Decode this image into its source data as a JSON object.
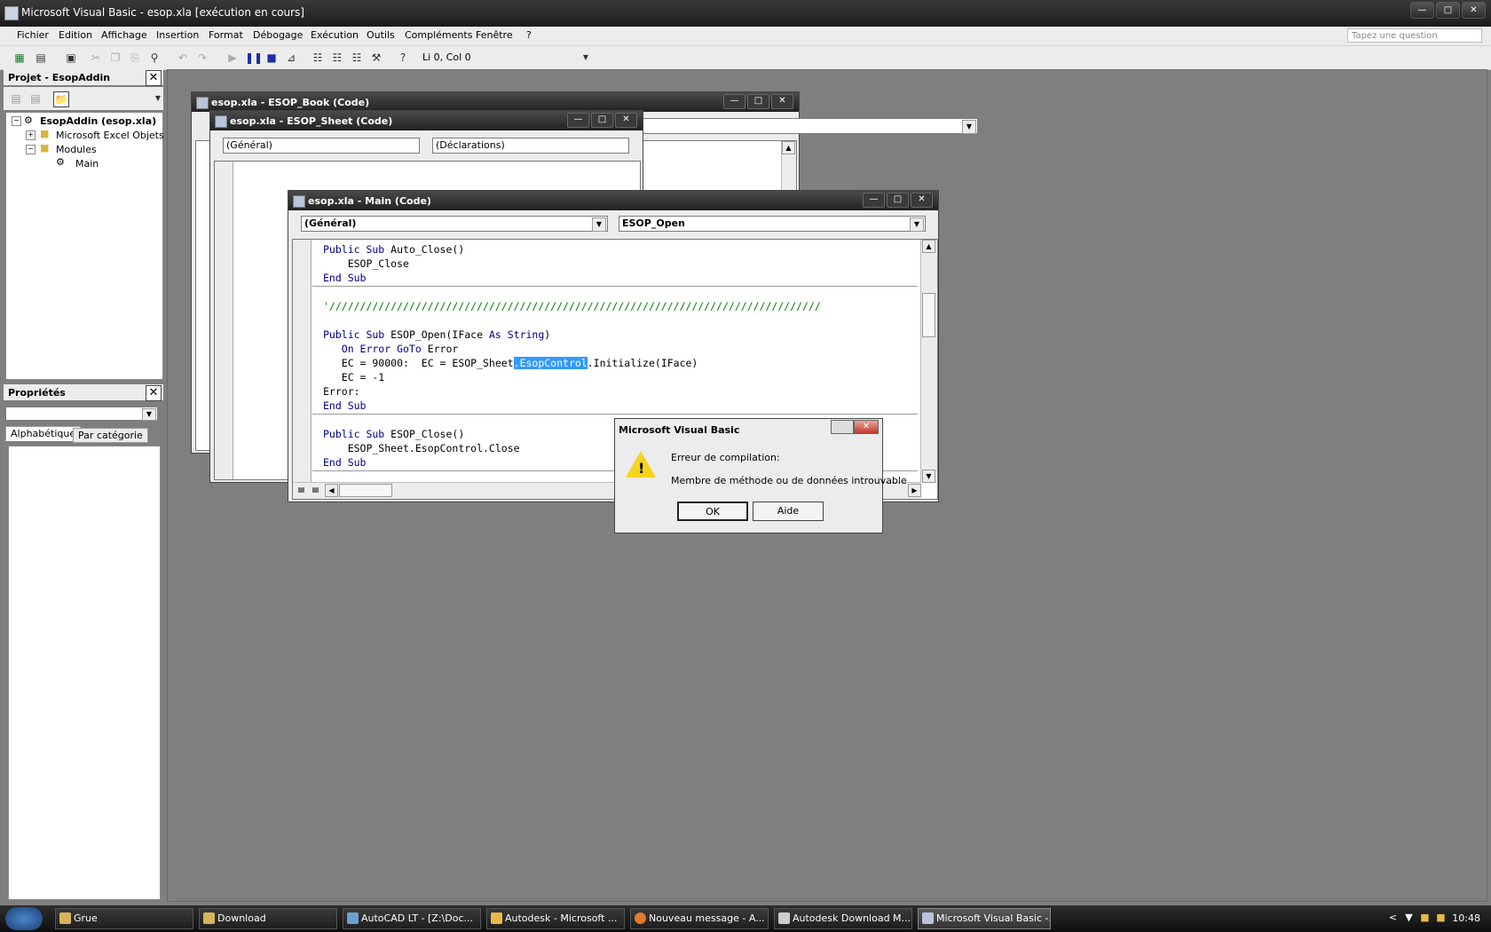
{
  "window": {
    "title": "Microsoft Visual Basic - esop.xla [exécution en cours]"
  },
  "menu": [
    "Fichier",
    "Edition",
    "Affichage",
    "Insertion",
    "Format",
    "Débogage",
    "Exécution",
    "Outils",
    "Compléments",
    "Fenêtre",
    "?"
  ],
  "ask_box": {
    "placeholder": "Tapez une question"
  },
  "toolbar": {
    "position": "Li 0, Col 0"
  },
  "project": {
    "title": "Projet - EsopAddin",
    "root": "EsopAddin (esop.xla)",
    "items": [
      "Microsoft Excel Objets",
      "Modules",
      "Main"
    ]
  },
  "properties": {
    "title": "Propriétés",
    "tabs": [
      "Alphabétique",
      "Par catégorie"
    ]
  },
  "book_window": {
    "title": "esop.xla - ESOP_Book (Code)"
  },
  "sheet_window": {
    "title": "esop.xla - ESOP_Sheet (Code)",
    "object": "(Général)",
    "proc": "(Déclarations)"
  },
  "main_window": {
    "title": "esop.xla - Main (Code)",
    "object": "(Général)",
    "proc": "ESOP_Open",
    "code": {
      "l1_kw": "Public Sub ",
      "l1_rest": "Auto_Close()",
      "l2": "    ESOP_Close",
      "l3": "End Sub",
      "l4": "'////////////////////////////////////////////////////////////////////////////////",
      "l5_kw": "Public Sub ",
      "l5_a": "ESOP_Open(IFace ",
      "l5_kw2": "As String",
      "l5_b": ")",
      "l6_kw": "   On Error GoTo ",
      "l6_rest": "Error",
      "l7_a": "   EC = 90000:  EC = ESOP_Sheet",
      "l7_hl": ".EsopControl",
      "l7_b": ".Initialize(IFace)",
      "l8": "   EC = -1",
      "l9": "Error:",
      "l10": "End Sub",
      "l11_kw": "Public Sub ",
      "l11_rest": "ESOP_Close()",
      "l12": "    ESOP_Sheet.EsopControl.Close",
      "l13": "End Sub"
    }
  },
  "dialog": {
    "title": "Microsoft Visual Basic",
    "line1": "Erreur de compilation:",
    "line2": "Membre de méthode ou de données introuvable",
    "ok": "OK",
    "help": "Aide"
  },
  "taskbar": {
    "tasks": [
      "Grue",
      "Download",
      "AutoCAD LT - [Z:\\Doc...",
      "Autodesk - Microsoft ...",
      "Nouveau message - A...",
      "Autodesk Download M...",
      "Microsoft Visual Basic -..."
    ],
    "clock": "10:48"
  }
}
